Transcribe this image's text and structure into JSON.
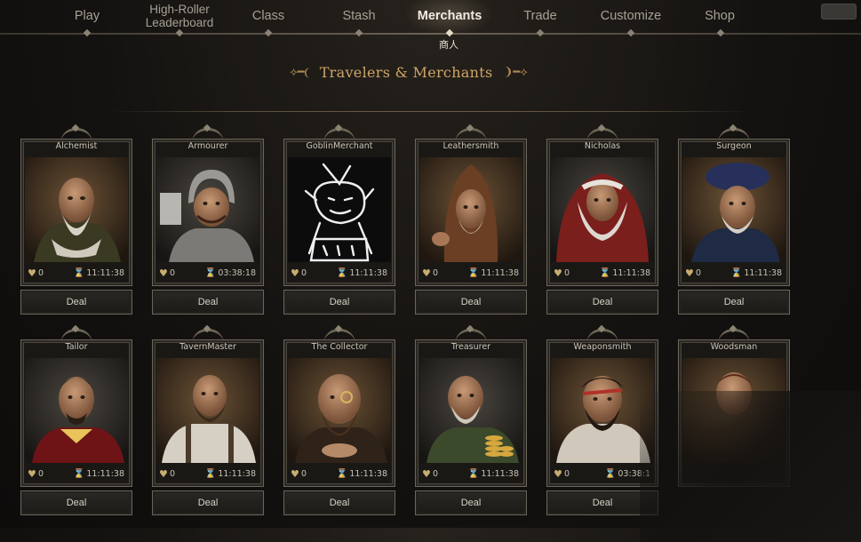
{
  "nav": {
    "tabs": [
      {
        "label": "Play"
      },
      {
        "label": "High-Roller Leaderboard"
      },
      {
        "label": "Class"
      },
      {
        "label": "Stash"
      },
      {
        "label": "Merchants",
        "active": true
      },
      {
        "label": "Trade"
      },
      {
        "label": "Customize"
      },
      {
        "label": "Shop"
      }
    ],
    "active_sub": "商人"
  },
  "heading": "Travelers & Merchants",
  "merchants": [
    {
      "name": "Alchemist",
      "affinity": "0",
      "timer": "11:11:38",
      "deal": "Deal"
    },
    {
      "name": "Armourer",
      "affinity": "0",
      "timer": "03:38:18",
      "deal": "Deal"
    },
    {
      "name": "GoblinMerchant",
      "affinity": "0",
      "timer": "11:11:38",
      "deal": "Deal"
    },
    {
      "name": "Leathersmith",
      "affinity": "0",
      "timer": "11:11:38",
      "deal": "Deal"
    },
    {
      "name": "Nicholas",
      "affinity": "0",
      "timer": "11:11:38",
      "deal": "Deal"
    },
    {
      "name": "Surgeon",
      "affinity": "0",
      "timer": "11:11:38",
      "deal": "Deal"
    },
    {
      "name": "Tailor",
      "affinity": "0",
      "timer": "11:11:38",
      "deal": "Deal"
    },
    {
      "name": "TavernMaster",
      "affinity": "0",
      "timer": "11:11:38",
      "deal": "Deal"
    },
    {
      "name": "The Collector",
      "affinity": "0",
      "timer": "11:11:38",
      "deal": "Deal"
    },
    {
      "name": "Treasurer",
      "affinity": "0",
      "timer": "11:11:38",
      "deal": "Deal"
    },
    {
      "name": "Weaponsmith",
      "affinity": "0",
      "timer": "03:38:1",
      "deal": "Deal"
    },
    {
      "name": "Woodsman",
      "affinity": "",
      "timer": "",
      "deal": ""
    }
  ],
  "colors": {
    "accent_gold": "#cfa566",
    "frame": "#6b655a",
    "background": "#141210"
  }
}
